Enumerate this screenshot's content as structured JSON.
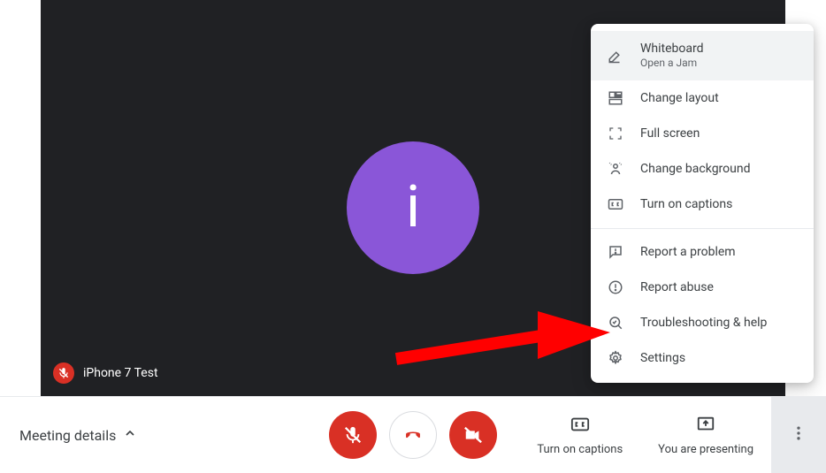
{
  "participant": {
    "avatar_letter": "i",
    "name": "iPhone 7 Test"
  },
  "bottom": {
    "meeting_details_label": "Meeting details",
    "captions_label": "Turn on captions",
    "presenting_label": "You are presenting"
  },
  "menu": {
    "whiteboard": {
      "label": "Whiteboard",
      "subtitle": "Open a Jam"
    },
    "change_layout": "Change layout",
    "full_screen": "Full screen",
    "change_background": "Change background",
    "turn_on_captions": "Turn on captions",
    "report_problem": "Report a problem",
    "report_abuse": "Report abuse",
    "troubleshooting": "Troubleshooting & help",
    "settings": "Settings"
  },
  "colors": {
    "accent_purple": "#8a56d8",
    "red": "#d93025",
    "arrow_red": "#ff0000"
  }
}
